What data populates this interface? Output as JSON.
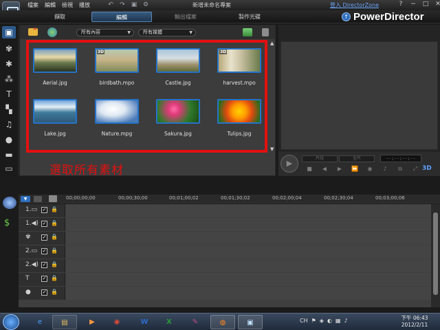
{
  "titlebar": {
    "menus": [
      "檔案",
      "編輯",
      "檢視",
      "播放"
    ],
    "project_title": "新增未命名專案",
    "login_link": "登入 DirectorZone",
    "window_controls": [
      "?",
      "−",
      "□",
      "✕"
    ]
  },
  "modes": {
    "capture": "擷取",
    "edit": "編輯",
    "produce": "輸出檔案",
    "disc": "製作光碟"
  },
  "brand": {
    "name": "PowerDirector"
  },
  "library": {
    "content_filter": "所有內容",
    "category_filter": "所有媒體",
    "media": [
      {
        "file": "Aerial.jpg",
        "is3d": false
      },
      {
        "file": "birdbath.mpo",
        "is3d": true
      },
      {
        "file": "Castle.jpg",
        "is3d": false
      },
      {
        "file": "harvest.mpo",
        "is3d": true
      },
      {
        "file": "Lake.jpg",
        "is3d": false
      },
      {
        "file": "Nature.mpg",
        "is3d": false
      },
      {
        "file": "Sakura.jpg",
        "is3d": false
      },
      {
        "file": "Tulips.jpg",
        "is3d": false
      }
    ],
    "badge_3d": "3D",
    "annotation": "選取所有素材"
  },
  "preview": {
    "clip_mode": "片段",
    "movie_mode": "全片",
    "timecode": "--;--;--;--",
    "badge_3d": "3D"
  },
  "timeline": {
    "timecodes": [
      "00;00;00;00",
      "00;00;30;00",
      "00;01;00;02",
      "00;01;30;02",
      "00;02;00;04",
      "00;02;30;04",
      "00;03;00;06"
    ],
    "tracks": [
      {
        "num": "1.",
        "icon": "video"
      },
      {
        "num": "1.",
        "icon": "audio"
      },
      {
        "num": "",
        "icon": "fx"
      },
      {
        "num": "2.",
        "icon": "video"
      },
      {
        "num": "2.",
        "icon": "audio"
      },
      {
        "num": "",
        "icon": "title"
      },
      {
        "num": "",
        "icon": "voice"
      }
    ]
  },
  "taskbar": {
    "tray_lang": "CH",
    "time": "下午 06:43",
    "date": "2012/2/11"
  }
}
